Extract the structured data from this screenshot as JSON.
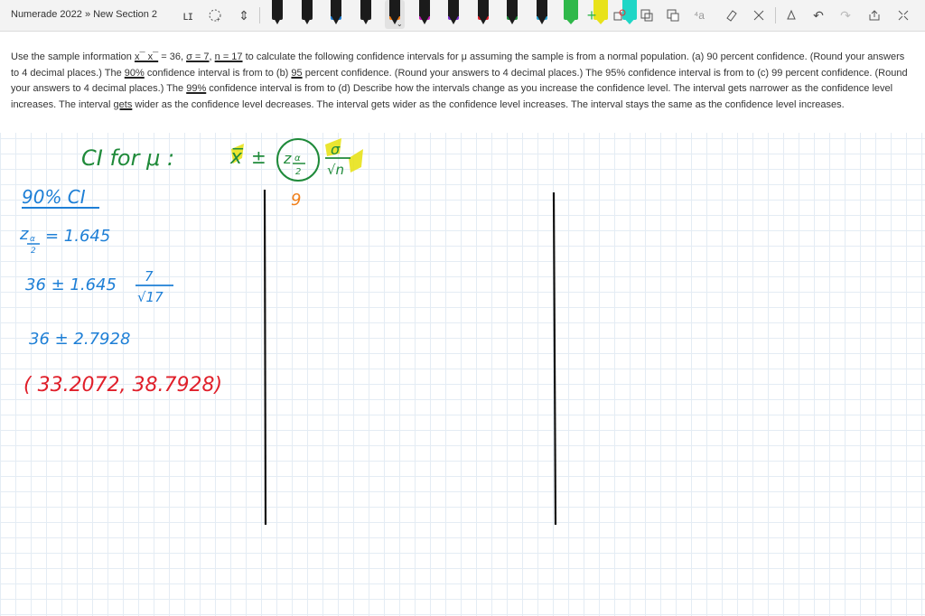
{
  "breadcrumb": "Numerade 2022 » New Section 2",
  "toolbar": {
    "tools": [
      {
        "name": "type-text-icon",
        "glyph": "ʟɪ"
      },
      {
        "name": "lasso-select-icon",
        "glyph": "⭕"
      },
      {
        "name": "add-space-icon",
        "glyph": "⇕"
      }
    ],
    "pens": [
      {
        "color": "#222222",
        "type": "pen"
      },
      {
        "color": "#222222",
        "type": "pen"
      },
      {
        "color": "#1e7fd6",
        "type": "pen"
      },
      {
        "color": "#222222",
        "type": "pen"
      },
      {
        "color": "#f07f1a",
        "type": "pen",
        "selected": true
      },
      {
        "color": "#c21fb8",
        "type": "pen"
      },
      {
        "color": "#7b2fcf",
        "type": "pen"
      },
      {
        "color": "#e01f2a",
        "type": "pen"
      },
      {
        "color": "#1f8a3a",
        "type": "pen"
      },
      {
        "color": "#2aa5d6",
        "type": "pen"
      },
      {
        "color": "#2fb84a",
        "type": "hl"
      },
      {
        "color": "#e8e21a",
        "type": "hl"
      },
      {
        "color": "#1fd6c6",
        "type": "hl"
      }
    ],
    "right_tools": [
      {
        "name": "add-pen-icon",
        "glyph": "+"
      },
      {
        "name": "ink-to-shape-icon",
        "glyph": "⭮"
      },
      {
        "name": "ink-to-text-icon",
        "glyph": "⧉"
      },
      {
        "name": "ink-to-math-icon",
        "glyph": "⧉"
      },
      {
        "name": "eraser-icon",
        "glyph": "◇"
      },
      {
        "name": "ruler-icon",
        "glyph": "∕"
      },
      {
        "name": "grid-icon",
        "glyph": "⌗"
      },
      {
        "name": "replay-icon",
        "glyph": "△"
      },
      {
        "name": "undo-icon",
        "glyph": "↶"
      },
      {
        "name": "redo-icon",
        "glyph": "↷"
      },
      {
        "name": "share-icon",
        "glyph": "⇱"
      },
      {
        "name": "collapse-icon",
        "glyph": "✖"
      }
    ]
  },
  "question": {
    "t1": "Use the sample information ",
    "xbar": "x¯ x¯",
    "t2": " = 36, ",
    "sigma": "σ = 7",
    "t3": ", ",
    "n": "n = 17",
    "t4": " to calculate the following confidence intervals for μ assuming the sample is from a normal population. (a) 90 percent confidence. (Round your answers to 4 decimal places.) The ",
    "p90": "90%",
    "t5": " confidence interval is from to (b) ",
    "p95": "95",
    "t6": " percent confidence. (Round your answers to 4 decimal places.) The 95% confidence interval is from to (c) 99 percent confidence. (Round your answers to 4 decimal places.) The ",
    "p99": "99%",
    "t7": " confidence interval is from to (d) Describe how the intervals change as you increase the confidence level. The interval gets narrower as the confidence level increases. The interval ",
    "gets": "gets",
    "t8": " wider as the confidence level decreases. The interval gets wider as the confidence level increases. The interval stays the same as the confidence level increases."
  },
  "handwriting": {
    "ci_label": "CI for μ :",
    "xbar": "x̅",
    "pm": "±",
    "z": "z",
    "alpha": "α",
    "two": "2",
    "sigma": "σ",
    "sqrt_n": "√n",
    "nine": "9",
    "heading": "90% CI",
    "z_sub_eq": "= 1.645",
    "line1_pre": "36 ±  1.645",
    "line1_num": "7",
    "line1_den": "√17",
    "line2": "36 ±   2.7928",
    "line3": "( 33.2072, 38.7928)"
  },
  "colors": {
    "green_ink": "#1f8a3a",
    "blue_ink": "#1e7fd6",
    "red_ink": "#e01f2a",
    "orange_ink": "#f07f1a",
    "highlight": "#e8e21a"
  }
}
